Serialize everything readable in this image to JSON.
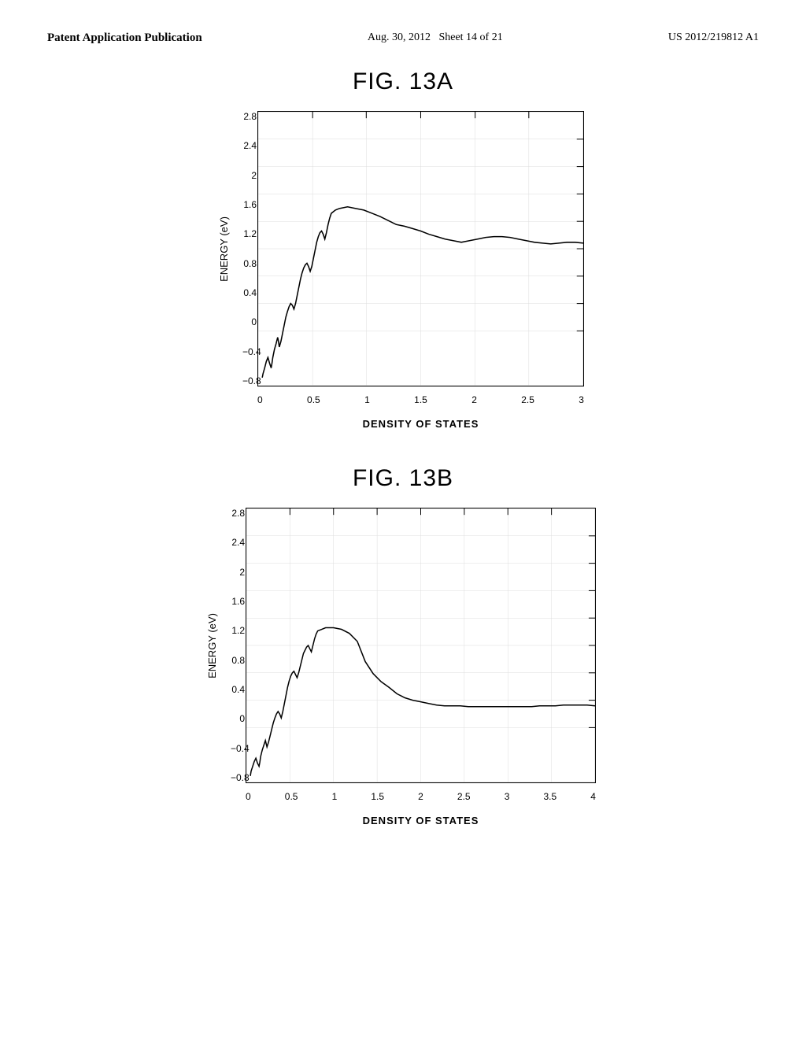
{
  "header": {
    "left": "Patent Application Publication",
    "center_date": "Aug. 30, 2012",
    "center_sheet": "Sheet 14 of 21",
    "right": "US 2012/219812 A1"
  },
  "fig13a": {
    "title": "FIG. 13A",
    "y_label": "ENERGY (eV)",
    "x_label": "DENSITY OF STATES",
    "y_ticks": [
      "2.8",
      "2.4",
      "2",
      "1.6",
      "1.2",
      "0.8",
      "0.4",
      "0",
      "-0.4",
      "-0.8"
    ],
    "x_ticks": [
      "0",
      "0.5",
      "1",
      "1.5",
      "2",
      "2.5",
      "3"
    ]
  },
  "fig13b": {
    "title": "FIG. 13B",
    "y_label": "ENERGY (eV)",
    "x_label": "DENSITY OF STATES",
    "y_ticks": [
      "2.8",
      "2.4",
      "2",
      "1.6",
      "1.2",
      "0.8",
      "0.4",
      "0",
      "-0.4",
      "-0.8"
    ],
    "x_ticks": [
      "0",
      "0.5",
      "1",
      "1.5",
      "2",
      "2.5",
      "3",
      "3.5",
      "4"
    ]
  }
}
